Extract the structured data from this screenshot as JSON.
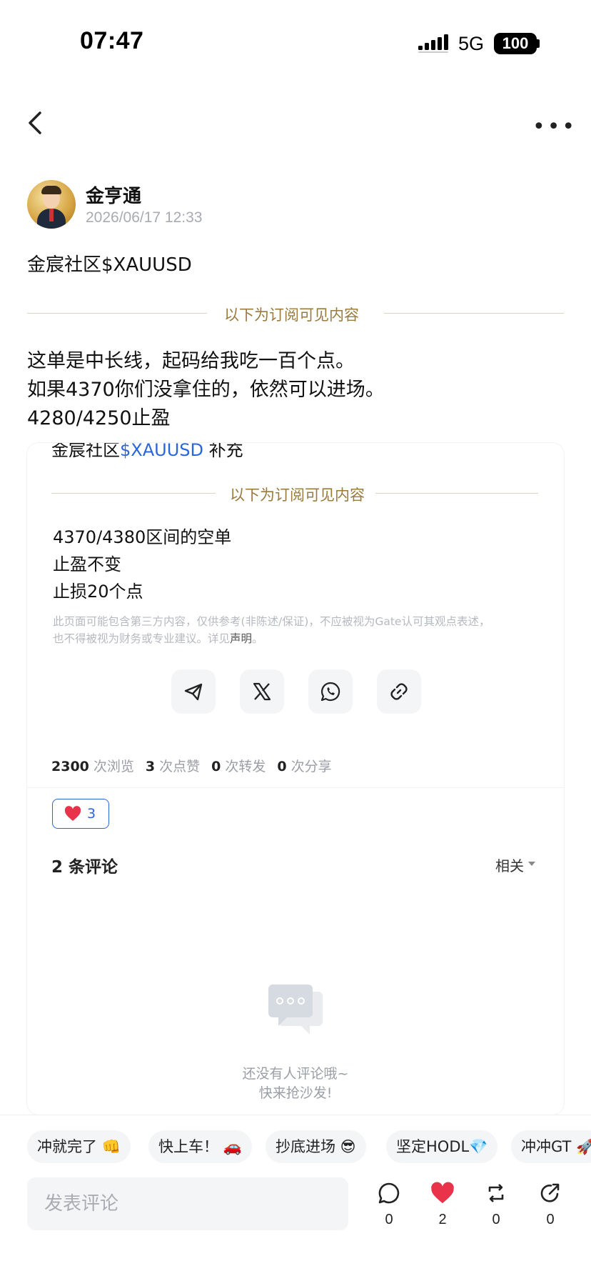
{
  "status_bar": {
    "time": "07:47",
    "network": "5G",
    "battery": "100"
  },
  "post": {
    "author_name": "金亨通",
    "timestamp": "2026/06/17 12:33",
    "tag_line": "金宸社区$XAUUSD",
    "subscriber_label": "以下为订阅可见内容",
    "content_lines": [
      "这单是中长线，起码给我吃一百个点。",
      "如果4370你们没拿住的，依然可以进场。",
      "4280/4250止盈"
    ]
  },
  "quoted_post": {
    "prefix": "金宸社区",
    "tag": "$XAUUSD",
    "suffix": " 补充",
    "subscriber_label": "以下为订阅可见内容",
    "content_lines": [
      "4370/4380区间的空单",
      "止盈不变",
      "止损20个点"
    ],
    "disclaimer_line1": "此页面可能包含第三方内容，仅供参考(非陈述/保证)，不应被视为Gate认可其观点表述，",
    "disclaimer_line2_prefix": "也不得被视为财务或专业建议。详见",
    "disclaimer_link": "声明",
    "disclaimer_end": "。"
  },
  "share_icons": [
    "telegram-icon",
    "x-icon",
    "whatsapp-icon",
    "link-icon"
  ],
  "stats": {
    "views": "2300",
    "views_label": "次浏览",
    "likes": "3",
    "likes_label": "次点赞",
    "reposts": "0",
    "reposts_label": "次转发",
    "shares": "0",
    "shares_label": "次分享"
  },
  "reaction": {
    "count": "3"
  },
  "comments": {
    "title": "2 条评论",
    "sort_label": "相关",
    "empty_line1": "还没有人评论哦~",
    "empty_line2": "快来抢沙发!"
  },
  "quick_replies": [
    "冲就完了 👊",
    "快上车！ 🚗",
    "抄底进场 😎",
    "坚定HODL💎",
    "冲冲GT 🚀"
  ],
  "input": {
    "placeholder": "发表评论"
  },
  "actions": {
    "comment_count": "0",
    "like_count": "2",
    "repost_count": "0",
    "share_count": "0"
  },
  "colors": {
    "accent": "#2a66d9",
    "gold_label": "#9a7a3d",
    "like_red": "#e8334a"
  }
}
